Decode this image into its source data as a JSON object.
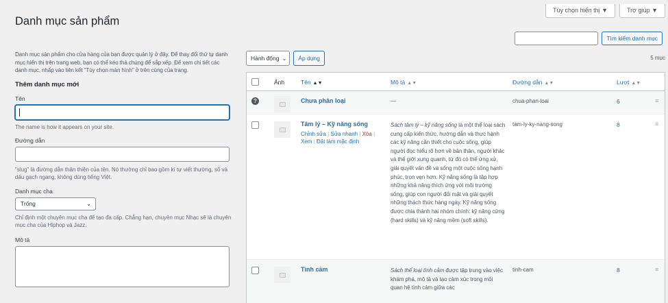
{
  "top_buttons": {
    "screen_options": "Tùy chọn hiển thị ▼",
    "help": "Trợ giúp ▼"
  },
  "page_title": "Danh mục sản phẩm",
  "search": {
    "button": "Tìm kiếm danh mục",
    "value": ""
  },
  "intro": "Danh mục sản phẩm cho cửa hàng của bạn được quản lý ở đây. Để thay đổi thứ tự danh mục hiển thị trên trang web, bạn có thể kéo thả chúng để sắp xếp. Để xem chi tiết các danh mục, nhấp vào liên kết \"Tùy chọn màn hình\" ở trên cùng của trang.",
  "form": {
    "title": "Thêm danh mục mới",
    "name_label": "Tên",
    "name_value": "",
    "name_help": "The name is how it appears on your site.",
    "slug_label": "Đường dẫn",
    "slug_value": "",
    "slug_help": "\"slug\" là đường dẫn thân thiện của tên. Nó thường chỉ bao gồm kí tự viết thường, số và dấu gạch ngang, không dùng tiếng Việt.",
    "parent_label": "Danh mục cha",
    "parent_selected": "Trống",
    "parent_help": "Chỉ định một chuyên mục cha để tạo đa cấp. Chẳng hạn, chuyên mục Nhạc sẽ là chuyên mục cha của Hiphop và Jazz.",
    "desc_label": "Mô tả"
  },
  "bulk": {
    "selected": "Hành động",
    "apply": "Áp dụng",
    "count": "5 mục"
  },
  "table": {
    "headers": {
      "image": "Ảnh",
      "name": "Tên",
      "description": "Mô tả",
      "slug": "Đường dẫn",
      "count": "Lượt",
      "sort_arrows": "▲▼"
    },
    "rows": [
      {
        "name": "Chưa phân loại",
        "description": "—",
        "slug": "chua-phan-loai",
        "count": "6",
        "help_icon": "?"
      },
      {
        "name": "Tâm lý – Kỹ năng sống",
        "actions": {
          "edit": "Chỉnh sửa",
          "quick": "Sửa nhanh",
          "delete": "Xóa",
          "view": "Xem",
          "default": "Đặt làm mặc định",
          "sep": "|"
        },
        "desc_em": "Sách tâm lý – kỹ năng sống",
        "desc_rest": " là một thể loại sách cung cấp kiến thức, hướng dẫn và thực hành các kỹ năng cần thiết cho cuộc sống, giúp người đọc hiểu rõ hơn về bản thân, người khác và thế giới xung quanh, từ đó có thể ứng xử, giải quyết vấn đề và sống một cuộc sống hạnh phúc, trọn vẹn hơn. Kỹ năng sống là tập hợp những khả năng thích ứng với môi trường sống, giúp con người đối mặt và giải quyết những thách thức hàng ngày. Kỹ năng sống được chia thành hai nhóm chính: kỹ năng cứng (hard skills) và kỹ năng mềm (soft skills).",
        "slug": "tam-ly-ky-nang-song",
        "count": "8"
      },
      {
        "name": "Tình cảm",
        "desc_em": "Sách thể loại tình cảm",
        "desc_rest": " được tập trung vào việc khám phá, mô tả và tạo cảm xúc trong mối quan hệ tình cảm giữa các",
        "slug": "tinh-cam",
        "count": "8"
      }
    ],
    "drag_icon": "≡"
  }
}
